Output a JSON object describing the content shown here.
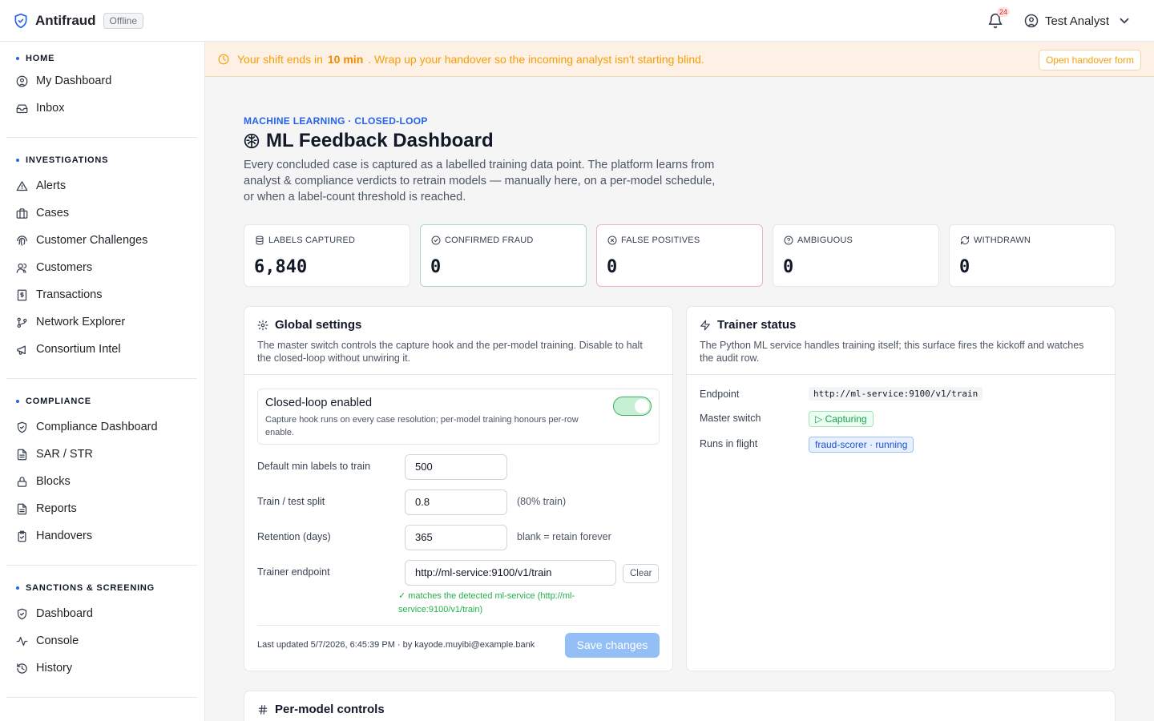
{
  "app": {
    "name": "Antifraud",
    "status_badge": "Offline"
  },
  "header": {
    "notification_count": "24",
    "user_name": "Test Analyst"
  },
  "sidebar": {
    "sections": [
      {
        "title": "HOME",
        "items": [
          "My Dashboard",
          "Inbox"
        ]
      },
      {
        "title": "INVESTIGATIONS",
        "items": [
          "Alerts",
          "Cases",
          "Customer Challenges",
          "Customers",
          "Transactions",
          "Network Explorer",
          "Consortium Intel"
        ]
      },
      {
        "title": "COMPLIANCE",
        "items": [
          "Compliance Dashboard",
          "SAR / STR",
          "Blocks",
          "Reports",
          "Handovers"
        ]
      },
      {
        "title": "SANCTIONS & SCREENING",
        "items": [
          "Dashboard",
          "Console",
          "History"
        ]
      }
    ]
  },
  "banner": {
    "text_before": "Your shift ends in",
    "time": "10 min",
    "text_after": ". Wrap up your handover so the incoming analyst isn't starting blind.",
    "button": "Open handover form",
    "color": "#f59e0b"
  },
  "page": {
    "eyebrow": "MACHINE LEARNING · CLOSED-LOOP",
    "title": "ML Feedback Dashboard",
    "intro": "Every concluded case is captured as a labelled training data point. The platform learns from analyst & compliance verdicts to retrain models — manually here, on a per-model schedule, or when a label-count threshold is reached."
  },
  "stats": [
    {
      "label": "LABELS CAPTURED",
      "value": "6,840",
      "icon": "database-icon"
    },
    {
      "label": "CONFIRMED FRAUD",
      "value": "0",
      "icon": "check-circle-icon"
    },
    {
      "label": "FALSE POSITIVES",
      "value": "0",
      "icon": "x-circle-icon"
    },
    {
      "label": "AMBIGUOUS",
      "value": "0",
      "icon": "help-circle-icon"
    },
    {
      "label": "WITHDRAWN",
      "value": "0",
      "icon": "refresh-icon"
    }
  ],
  "global_settings": {
    "title": "Global settings",
    "description": "The master switch controls the capture hook and the per-model training. Disable to halt the closed-loop without unwiring it.",
    "toggle_title": "Closed-loop enabled",
    "toggle_desc": "Capture hook runs on every case resolution; per-model training honours per-row enable.",
    "toggle_on": true,
    "min_labels_label": "Default min labels to train",
    "min_labels_value": "500",
    "split_label": "Train / test split",
    "split_value": "0.8",
    "split_hint": "(80% train)",
    "retention_label": "Retention (days)",
    "retention_value": "365",
    "retention_hint": "blank = retain forever",
    "endpoint_label": "Trainer endpoint",
    "endpoint_value": "http://ml-service:9100/v1/train",
    "clear_label": "Clear",
    "match_text": "✓ matches the detected ml-service (http://ml-service:9100/v1/train)",
    "last_updated": "Last updated 5/7/2026, 6:45:39 PM · by kayode.muyibi@example.bank",
    "save_label": "Save changes"
  },
  "trainer_status": {
    "title": "Trainer status",
    "description": "The Python ML service handles training itself; this surface fires the kickoff and watches the audit row.",
    "endpoint_label": "Endpoint",
    "endpoint_value": "http://ml-service:9100/v1/train",
    "switch_label": "Master switch",
    "switch_value": "▷ Capturing",
    "runs_label": "Runs in flight",
    "runs_value": "fraud-scorer · running"
  },
  "per_model": {
    "title": "Per-model controls"
  }
}
